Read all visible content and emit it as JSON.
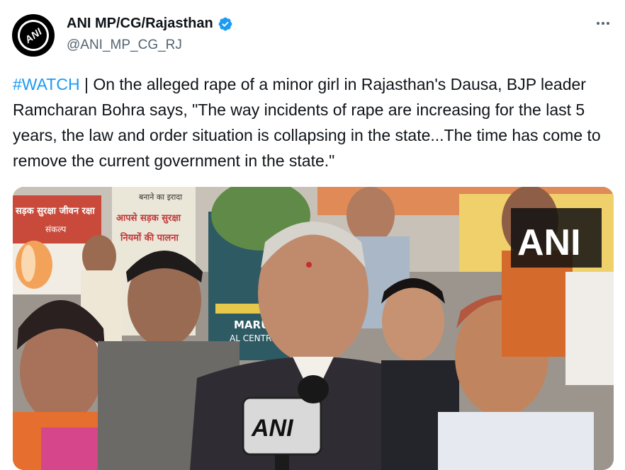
{
  "account": {
    "avatar_text": "ANI",
    "display_name": "ANI MP/CG/Rajasthan",
    "handle": "@ANI_MP_CG_RJ",
    "verified": true
  },
  "tweet": {
    "hashtag": "#WATCH",
    "separator": " | ",
    "text": "On the alleged rape of a minor girl in Rajasthan's Dausa, BJP leader Ramcharan Bohra says, \"The way incidents of rape are increasing for the last 5 years, the law and order situation is collapsing in the state...The time has come to remove the current government in the state.\""
  },
  "media": {
    "watermark": "ANI",
    "mic_label": "ANI",
    "sign_left_top": "सड़क सुरक्षा जीवन रक्षा",
    "sign_left_sub": "संकल्प",
    "sign_center_1": "बनाने का इरादा",
    "sign_center_2": "आपसे सड़क सुरक्षा",
    "sign_center_3": "नियमों की पालना",
    "sign_marudhar_1": "MARUDHA",
    "sign_marudhar_2": "AL CENTRE"
  },
  "icons": {
    "more": "more-options-icon",
    "verified": "verified-badge-icon"
  },
  "colors": {
    "link": "#1d9bf0",
    "secondary_text": "#536471",
    "verified": "#1d9bf0"
  }
}
